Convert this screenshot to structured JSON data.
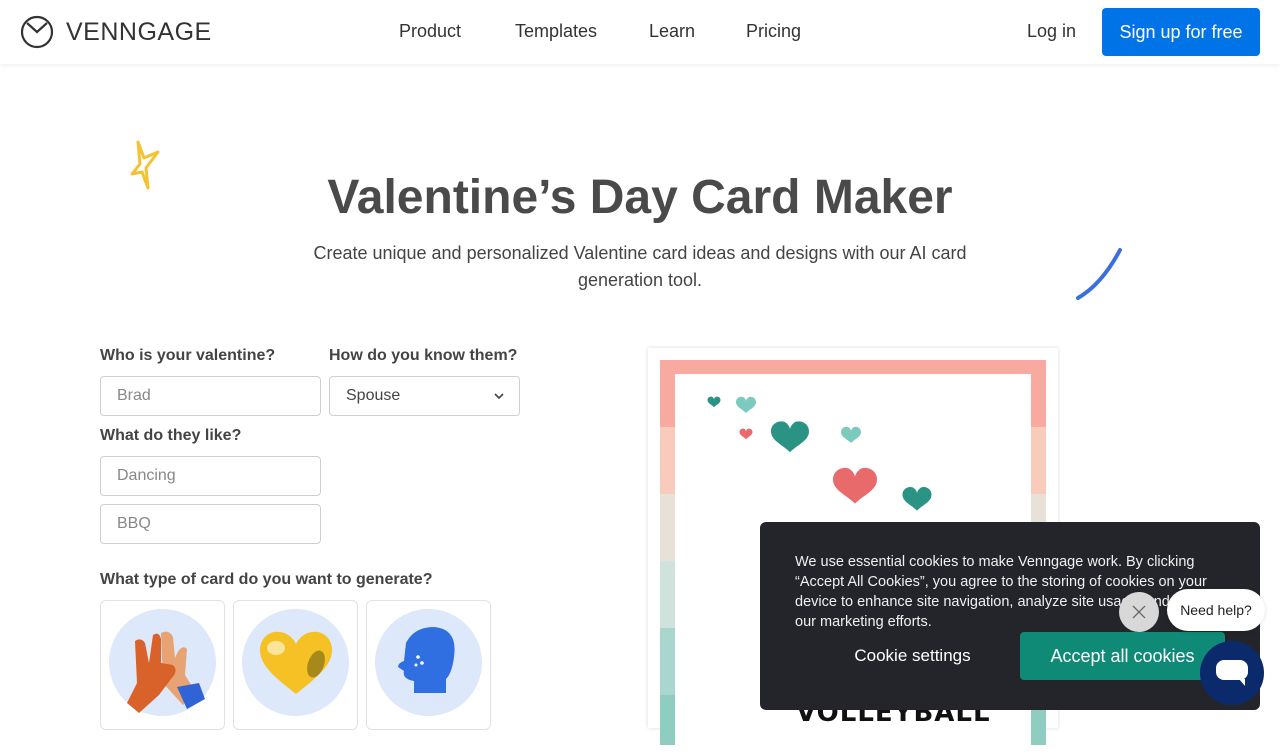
{
  "header": {
    "brand": "VENNGAGE",
    "nav": [
      {
        "label": "Product"
      },
      {
        "label": "Templates"
      },
      {
        "label": "Learn"
      },
      {
        "label": "Pricing"
      }
    ],
    "login_label": "Log in",
    "signup_label": "Sign up for free"
  },
  "hero": {
    "title": "Valentine’s Day Card Maker",
    "subtitle": "Create unique and personalized Valentine card ideas and designs with our AI card generation tool."
  },
  "form": {
    "valentine_label": "Who is your valentine?",
    "valentine_placeholder": "Brad",
    "relation_label": "How do you know them?",
    "relation_value": "Spouse",
    "likes_label": "What do they like?",
    "likes_placeholders": [
      "Dancing",
      "BBQ"
    ],
    "card_type_label": "What type of card do you want to generate?",
    "card_types": [
      {
        "icon": "high-five-icon"
      },
      {
        "icon": "yellow-heart-icon"
      },
      {
        "icon": "laughing-head-icon"
      }
    ]
  },
  "preview": {
    "card_text": "VOLLEYBALL"
  },
  "cookie_banner": {
    "text": "We use essential cookies to make Venngage work. By clicking “Accept All Cookies”, you agree to the storing of cookies on your device to enhance site navigation, analyze site usage, and assist in our marketing efforts.",
    "settings_label": "Cookie settings",
    "accept_label": "Accept all cookies"
  },
  "help_widget": {
    "bubble_text": "Need help?"
  },
  "colors": {
    "primary": "#0073e6",
    "accept": "#0e8a77",
    "banner_bg": "#24252b",
    "help_btn": "#0b2a6b"
  }
}
